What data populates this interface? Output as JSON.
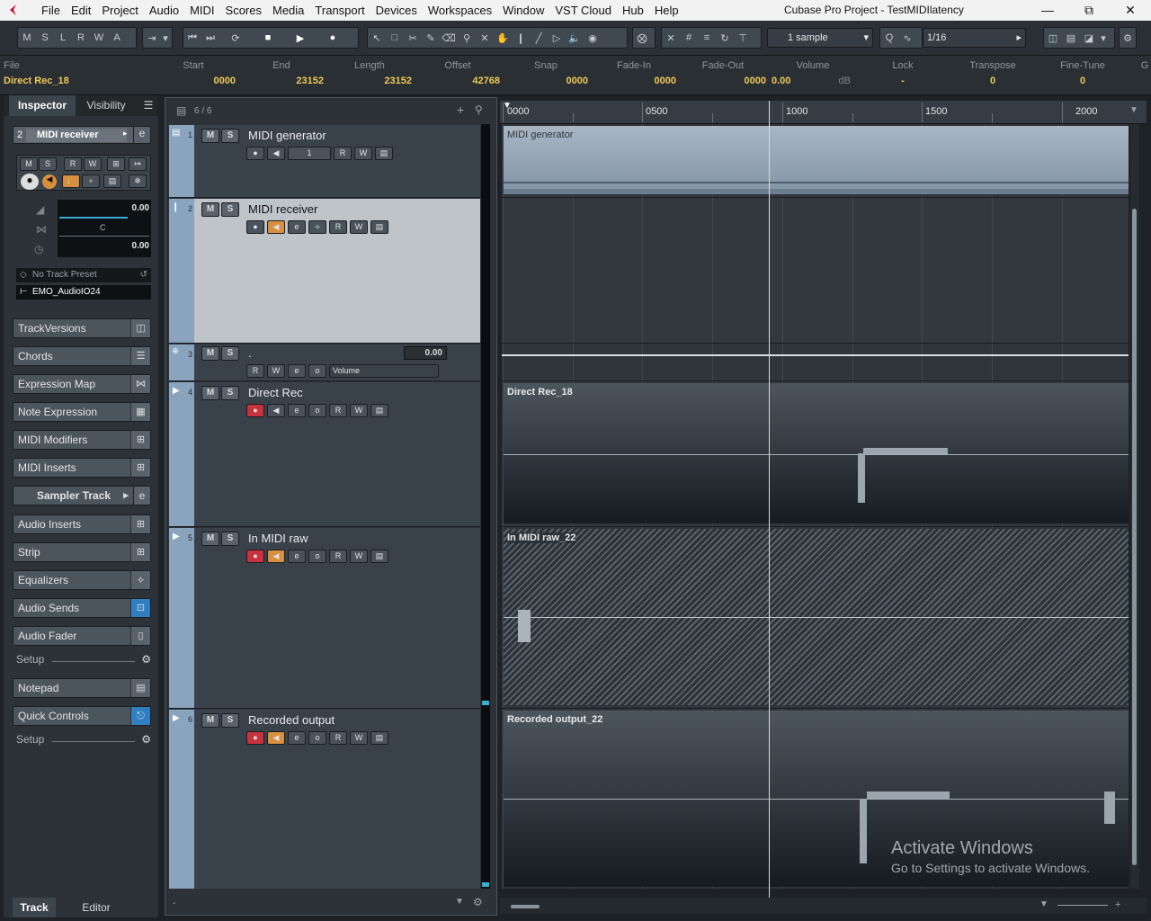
{
  "window": {
    "title": "Cubase Pro Project - TestMIDIlatency",
    "menus": [
      "File",
      "Edit",
      "Project",
      "Audio",
      "MIDI",
      "Scores",
      "Media",
      "Transport",
      "Devices",
      "Workspaces",
      "Window",
      "VST Cloud",
      "Hub",
      "Help"
    ]
  },
  "toolbar": {
    "state_buttons": [
      "M",
      "S",
      "L",
      "R",
      "W",
      "A"
    ],
    "snap_value": "1 sample",
    "quantize_value": "1/16"
  },
  "infoline": {
    "columns": [
      {
        "header": "File",
        "value": "Direct Rec_18"
      },
      {
        "header": "Start",
        "value": "0000"
      },
      {
        "header": "End",
        "value": "23152"
      },
      {
        "header": "Length",
        "value": "23152"
      },
      {
        "header": "Offset",
        "value": "42768"
      },
      {
        "header": "Snap",
        "value": "0000"
      },
      {
        "header": "Fade-In",
        "value": "0000"
      },
      {
        "header": "Fade-Out",
        "value": "0000"
      },
      {
        "header": "Volume",
        "value": "0.00"
      },
      {
        "header": "Lock",
        "value": "-"
      },
      {
        "header": "Transpose",
        "value": "0"
      },
      {
        "header": "Fine-Tune",
        "value": "0"
      }
    ],
    "volume_unit": "dB",
    "overflow_header": "G"
  },
  "inspector": {
    "tabs": [
      "Inspector",
      "Visibility"
    ],
    "track_number": "2",
    "track_name": "MIDI receiver",
    "button_row": [
      "M",
      "S",
      "R",
      "W"
    ],
    "volume_value": "0.00",
    "pan_value": "C",
    "delay_value": "0.00",
    "preset": "No Track Preset",
    "output": "EMO_AudioIO24",
    "sections": [
      "TrackVersions",
      "Chords",
      "Expression Map",
      "Note Expression",
      "MIDI Modifiers",
      "MIDI Inserts",
      "Sampler Track",
      "Audio Inserts",
      "Strip",
      "Equalizers",
      "Audio Sends",
      "Audio Fader",
      "Notepad",
      "Quick Controls"
    ],
    "setup_label": "Setup",
    "bottom_tabs": [
      "Track",
      "Editor"
    ]
  },
  "tracklist": {
    "count": "6 / 6",
    "tracks": [
      {
        "num": "1",
        "name": "MIDI generator",
        "channel": "1"
      },
      {
        "num": "2",
        "name": "MIDI receiver"
      },
      {
        "num": "3",
        "name": ".",
        "value": "0.00",
        "automation": "Volume"
      },
      {
        "num": "4",
        "name": "Direct Rec"
      },
      {
        "num": "5",
        "name": "In MIDI raw"
      },
      {
        "num": "6",
        "name": "Recorded output"
      }
    ],
    "button_labels": {
      "mute": "M",
      "solo": "S",
      "read": "R",
      "write": "W"
    }
  },
  "ruler": {
    "ticks": [
      "0000",
      "0500",
      "1000",
      "1500",
      "2000"
    ]
  },
  "events": [
    {
      "name": "MIDI generator",
      "lane": "1"
    },
    {
      "name": "Direct Rec_18",
      "lane": "4"
    },
    {
      "name": "In MIDI raw_22",
      "lane": "5"
    },
    {
      "name": "Recorded output_22",
      "lane": "6"
    }
  ],
  "watermark": {
    "line1": "Activate Windows",
    "line2": "Go to Settings to activate Windows."
  },
  "colors": {
    "accent_yellow": "#f0c85a",
    "record_red": "#c8323c",
    "monitor_orange": "#d89040",
    "track_strip_blue": "#8aa4be"
  }
}
